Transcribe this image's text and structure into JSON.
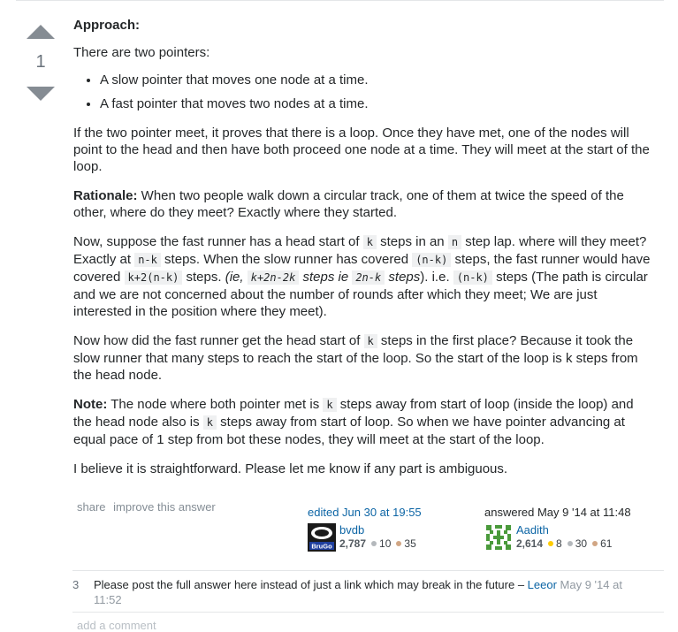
{
  "vote": {
    "count": "1"
  },
  "post": {
    "approach_heading": "Approach:",
    "intro": "There are two pointers:",
    "bullets": [
      "A slow pointer that moves one node at a time.",
      "A fast pointer that moves two nodes at a time."
    ],
    "para_loop": "If the two pointer meet, it proves that there is a loop. Once they have met, one of the nodes will point to the head and then have both proceed one node at a time. They will meet at the start of the loop.",
    "rationale_label": "Rationale:",
    "rationale_text": " When two people walk down a circular track, one of them at twice the speed of the other, where do they meet? Exactly where they started.",
    "p4": {
      "t1": "Now, suppose the fast runner has a head start of ",
      "c1": "k",
      "t2": " steps in an ",
      "c2": "n",
      "t3": " step lap. where will they meet? Exactly at ",
      "c3": "n-k",
      "t4": " steps. When the slow runner has covered ",
      "c4": "(n-k)",
      "t5": " steps, the fast runner would have covered ",
      "c5": "k+2(n-k)",
      "t6": " steps. ",
      "e1": "(ie, ",
      "c6": "k+2n-2k",
      "e2": " steps ie ",
      "c7": "2n-k",
      "e3": " steps",
      "t7": "). i.e. ",
      "c8": "(n-k)",
      "t8": " steps (The path is circular and we are not concerned about the number of rounds after which they meet; We are just interested in the position where they meet)."
    },
    "p5": {
      "t1": "Now how did the fast runner get the head start of ",
      "c1": "k",
      "t2": " steps in the first place? Because it took the slow runner that many steps to reach the start of the loop. So the start of the loop is k steps from the head node."
    },
    "note": {
      "label": "Note:",
      "t1": " The node where both pointer met is ",
      "c1": "k",
      "t2": " steps away from start of loop (inside the loop) and the head node also is ",
      "c2": "k",
      "t3": " steps away from start of loop. So when we have pointer advancing at equal pace of 1 step from bot these nodes, they will meet at the start of the loop."
    },
    "closing": "I believe it is straightforward. Please let me know if any part is ambiguous."
  },
  "meta": {
    "share": "share",
    "improve": "improve this answer"
  },
  "editor": {
    "action": "edited Jun 30 at 19:55",
    "name": "bvdb",
    "avatar_text": "BruGo",
    "rep": "2,787",
    "silver": "10",
    "bronze": "35"
  },
  "answerer": {
    "action": "answered May 9 '14 at 11:48",
    "name": "Aadith",
    "rep": "2,614",
    "gold": "8",
    "silver": "30",
    "bronze": "61"
  },
  "comments": [
    {
      "score": "3",
      "text": "Please post the full answer here instead of just a link which may break in the future",
      "sep": " – ",
      "user": "Leeor",
      "date": "May 9 '14 at 11:52"
    }
  ],
  "add_comment": "add a comment",
  "colors": {
    "link": "#0c65a5",
    "vote_arrow": "#858c93",
    "gold": "#ffcc01",
    "silver": "#b4b8bc",
    "bronze": "#d1a684"
  }
}
